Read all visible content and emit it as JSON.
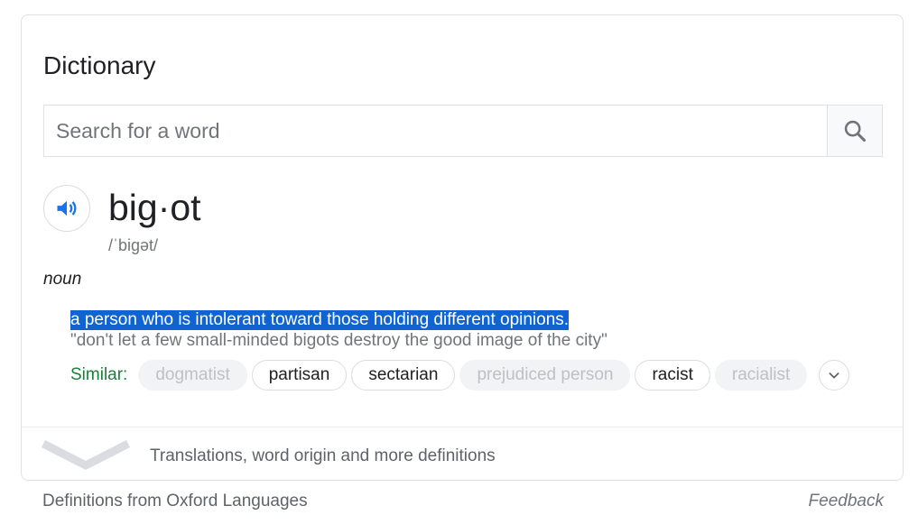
{
  "card": {
    "title": "Dictionary",
    "search": {
      "placeholder": "Search for a word",
      "value": ""
    },
    "entry": {
      "word": "big·ot",
      "phonetic": "/ˈbiɡət/",
      "part_of_speech": "noun",
      "definition": "a person who is intolerant toward those holding different opinions.",
      "example": "\"don't let a few small-minded bigots destroy the good image of the city\"",
      "similar_label": "Similar:",
      "similar": [
        {
          "label": "dogmatist",
          "state": "faded"
        },
        {
          "label": "partisan",
          "state": "active"
        },
        {
          "label": "sectarian",
          "state": "active"
        },
        {
          "label": "prejudiced person",
          "state": "faded"
        },
        {
          "label": "racist",
          "state": "active"
        },
        {
          "label": "racialist",
          "state": "faded"
        }
      ]
    },
    "more_text": "Translations, word origin and more definitions"
  },
  "footer": {
    "source": "Definitions from Oxford Languages",
    "feedback": "Feedback"
  },
  "colors": {
    "highlight": "#0f64d2",
    "similar_label": "#188038",
    "speaker_icon": "#1a73e8"
  },
  "icons": {
    "search": "search-icon",
    "speaker": "speaker-icon",
    "expand_similar": "chevron-down-icon",
    "expand_more": "chevron-down-icon"
  }
}
